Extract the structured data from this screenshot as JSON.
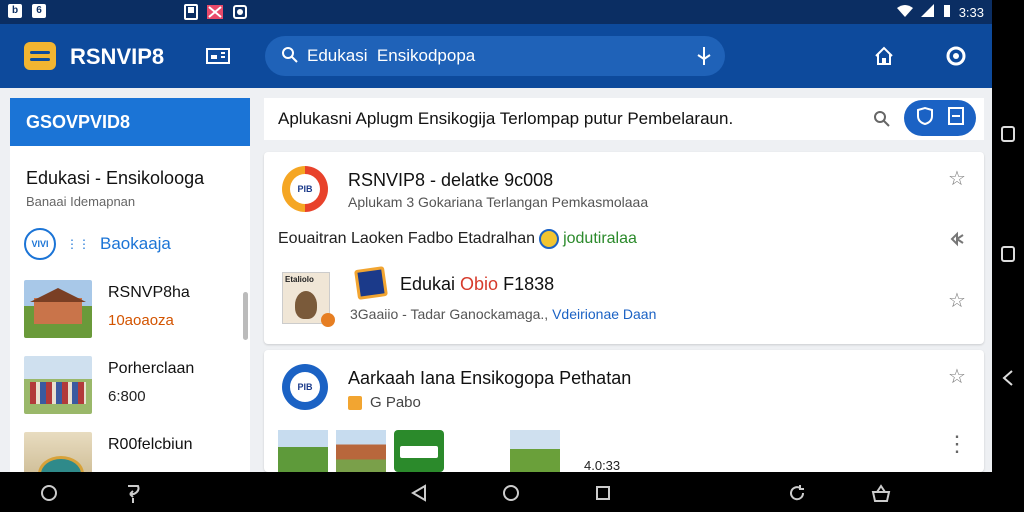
{
  "status_bar": {
    "left_icons": [
      "b",
      "6"
    ],
    "time": "3:33"
  },
  "app_bar": {
    "title": "RSNVIP8",
    "search_value": "Edukasi  Ensikodpopa",
    "search_placeholder": "Edukasi  Ensikodpopa"
  },
  "sidebar": {
    "header": "GSOVPVID8",
    "title": "Edukasi - Ensikolooga",
    "subtitle": "Banaai Idemapnan",
    "chip_badge": "VIVI",
    "chip_label": "Baokaaja",
    "items": [
      {
        "title": "RSNVP8ha",
        "meta": "10aoaoza"
      },
      {
        "title": "Porherclaan",
        "meta": "6:800"
      },
      {
        "title": "R00felcbiun",
        "meta": ""
      }
    ]
  },
  "main": {
    "header_title": "Aplukasni Aplugm Ensikogija Terlompap putur Pembelaraun."
  },
  "cards": {
    "card1": {
      "badge_text": "PIB",
      "title": "RSNVIP8 - delatke 9c008",
      "subtitle": "Aplukam 3 Gokariana Terlangan Pemkasmolaaa",
      "line_text": "Eouaitran Laoken Fadbo Etadralhan",
      "line_highlight": "jodutiralaa",
      "portrait_label": "Etaliolo",
      "inline_title_prefix": "Edukai ",
      "inline_title_highlight": "Obio",
      "inline_title_suffix": " F1838",
      "meta_a": "3Gaaiio - Tadar Ganockamaga.,",
      "meta_b": "Vdeirionae Daan"
    },
    "card2": {
      "badge_text": "PIB",
      "title": "Aarkaah Iana Ensikogopa Pethatan",
      "subtitle": "G Pabo",
      "date": "4.0:33"
    }
  }
}
